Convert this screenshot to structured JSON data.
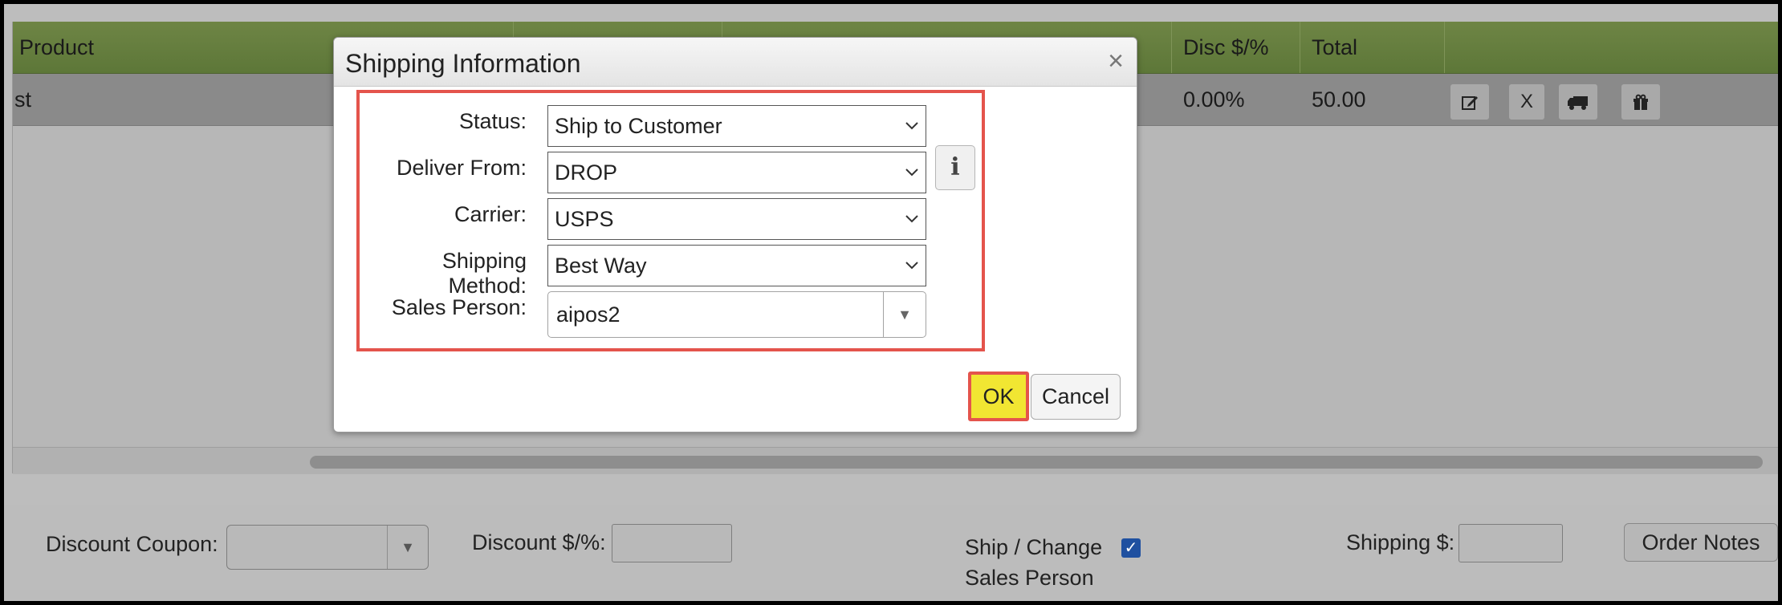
{
  "grid": {
    "headers": {
      "product": "Product",
      "disc": "Disc $/%",
      "total": "Total"
    },
    "row": {
      "product": "st",
      "disc": "0.00%",
      "total": "50.00",
      "delete_label": "X"
    }
  },
  "footer": {
    "discount_coupon_label": "Discount Coupon:",
    "discount_label": "Discount $/%:",
    "discount_value": "",
    "ship_change_line1": "Ship / Change",
    "ship_change_line2": "Sales Person",
    "ship_change_checked": true,
    "shipping_label": "Shipping $:",
    "shipping_value": "",
    "order_notes_label": "Order Notes"
  },
  "modal": {
    "title": "Shipping Information",
    "close": "×",
    "fields": {
      "status": {
        "label": "Status:",
        "value": "Ship to Customer"
      },
      "deliver_from": {
        "label": "Deliver From:",
        "value": "DROP"
      },
      "carrier": {
        "label": "Carrier:",
        "value": "USPS"
      },
      "shipping_method": {
        "label": "Shipping Method:",
        "value": "Best Way"
      },
      "sales_person": {
        "label": "Sales Person:",
        "value": "aipos2"
      }
    },
    "info_glyph": "i",
    "ok_label": "OK",
    "cancel_label": "Cancel"
  },
  "colors": {
    "header_green": "#6e8545",
    "highlight_red": "#e4544c",
    "ok_yellow": "#f1e632",
    "checkbox_blue": "#1f50a0"
  },
  "icons": {
    "row_actions": [
      "edit-icon",
      "delete-icon",
      "truck-icon",
      "gift-icon"
    ],
    "dropdown": "chevron-down-icon",
    "info": "info-icon",
    "close": "close-icon",
    "checkbox": "checkmark-icon"
  }
}
